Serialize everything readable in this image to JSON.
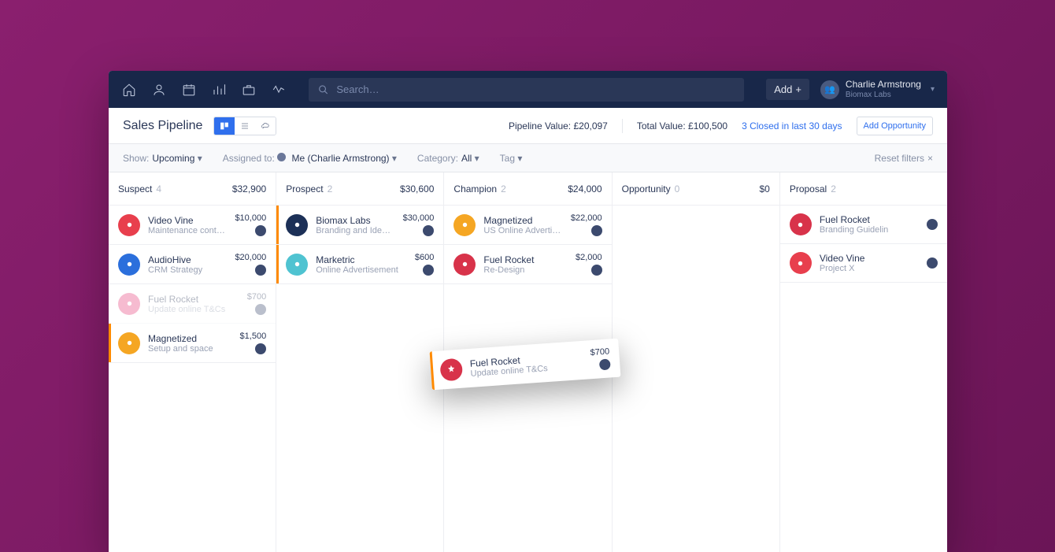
{
  "topbar": {
    "search_placeholder": "Search…",
    "add_label": "Add",
    "user_name": "Charlie Armstrong",
    "user_org": "Biomax Labs"
  },
  "subheader": {
    "title": "Sales Pipeline",
    "pipeline_value_label": "Pipeline Value:",
    "pipeline_value": "£20,097",
    "total_value_label": "Total Value:",
    "total_value": "£100,500",
    "closed_link": "3 Closed in last 30 days",
    "add_opportunity": "Add Opportunity"
  },
  "filters": {
    "show_label": "Show:",
    "show_value": "Upcoming",
    "assigned_label": "Assigned to:",
    "assigned_value": "Me (Charlie Armstrong)",
    "category_label": "Category:",
    "category_value": "All",
    "tag_label": "Tag",
    "reset": "Reset filters"
  },
  "columns": [
    {
      "title": "Suspect",
      "count": "4",
      "value": "$32,900",
      "cards": [
        {
          "icon_color": "ic-red",
          "title": "Video Vine",
          "sub": "Maintenance contract",
          "amount": "$10,000",
          "accent": false,
          "ghost": false
        },
        {
          "icon_color": "ic-blue",
          "title": "AudioHive",
          "sub": "CRM Strategy",
          "amount": "$20,000",
          "accent": false,
          "ghost": false
        },
        {
          "icon_color": "ic-pink",
          "title": "Fuel Rocket",
          "sub": "Update online T&Cs",
          "amount": "$700",
          "accent": false,
          "ghost": true
        },
        {
          "icon_color": "ic-orange",
          "title": "Magnetized",
          "sub": "Setup and space",
          "amount": "$1,500",
          "accent": true,
          "ghost": false
        }
      ]
    },
    {
      "title": "Prospect",
      "count": "2",
      "value": "$30,600",
      "cards": [
        {
          "icon_color": "ic-navy",
          "title": "Biomax Labs",
          "sub": "Branding and Identity",
          "amount": "$30,000",
          "accent": true,
          "ghost": false
        },
        {
          "icon_color": "ic-teal",
          "title": "Marketric",
          "sub": "Online Advertisement",
          "amount": "$600",
          "accent": true,
          "ghost": false
        }
      ]
    },
    {
      "title": "Champion",
      "count": "2",
      "value": "$24,000",
      "cards": [
        {
          "icon_color": "ic-orange",
          "title": "Magnetized",
          "sub": "US Online Advertiseme…",
          "amount": "$22,000",
          "accent": false,
          "ghost": false
        },
        {
          "icon_color": "ic-crimson",
          "title": "Fuel Rocket",
          "sub": "Re-Design",
          "amount": "$2,000",
          "accent": false,
          "ghost": false
        }
      ]
    },
    {
      "title": "Opportunity",
      "count": "0",
      "value": "$0",
      "cards": []
    },
    {
      "title": "Proposal",
      "count": "2",
      "value": "",
      "cards": [
        {
          "icon_color": "ic-crimson",
          "title": "Fuel Rocket",
          "sub": "Branding Guidelin",
          "amount": "",
          "accent": false,
          "ghost": false
        },
        {
          "icon_color": "ic-red",
          "title": "Video Vine",
          "sub": "Project X",
          "amount": "",
          "accent": false,
          "ghost": false
        }
      ]
    }
  ],
  "drag": {
    "title": "Fuel Rocket",
    "sub": "Update online T&Cs",
    "amount": "$700"
  }
}
